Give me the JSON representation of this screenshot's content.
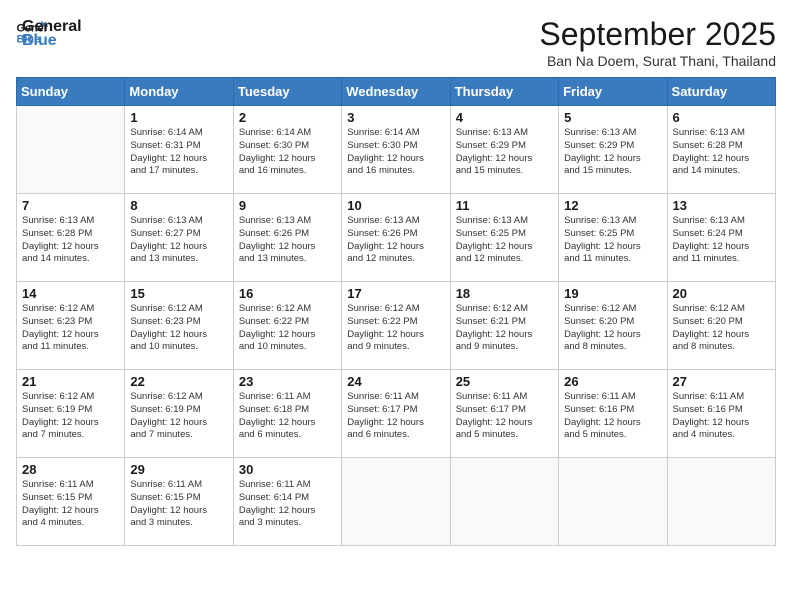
{
  "logo": {
    "line1": "General",
    "line2": "Blue"
  },
  "title": "September 2025",
  "subtitle": "Ban Na Doem, Surat Thani, Thailand",
  "days_of_week": [
    "Sunday",
    "Monday",
    "Tuesday",
    "Wednesday",
    "Thursday",
    "Friday",
    "Saturday"
  ],
  "weeks": [
    [
      {
        "day": "",
        "info": ""
      },
      {
        "day": "1",
        "info": "Sunrise: 6:14 AM\nSunset: 6:31 PM\nDaylight: 12 hours\nand 17 minutes."
      },
      {
        "day": "2",
        "info": "Sunrise: 6:14 AM\nSunset: 6:30 PM\nDaylight: 12 hours\nand 16 minutes."
      },
      {
        "day": "3",
        "info": "Sunrise: 6:14 AM\nSunset: 6:30 PM\nDaylight: 12 hours\nand 16 minutes."
      },
      {
        "day": "4",
        "info": "Sunrise: 6:13 AM\nSunset: 6:29 PM\nDaylight: 12 hours\nand 15 minutes."
      },
      {
        "day": "5",
        "info": "Sunrise: 6:13 AM\nSunset: 6:29 PM\nDaylight: 12 hours\nand 15 minutes."
      },
      {
        "day": "6",
        "info": "Sunrise: 6:13 AM\nSunset: 6:28 PM\nDaylight: 12 hours\nand 14 minutes."
      }
    ],
    [
      {
        "day": "7",
        "info": "Sunrise: 6:13 AM\nSunset: 6:28 PM\nDaylight: 12 hours\nand 14 minutes."
      },
      {
        "day": "8",
        "info": "Sunrise: 6:13 AM\nSunset: 6:27 PM\nDaylight: 12 hours\nand 13 minutes."
      },
      {
        "day": "9",
        "info": "Sunrise: 6:13 AM\nSunset: 6:26 PM\nDaylight: 12 hours\nand 13 minutes."
      },
      {
        "day": "10",
        "info": "Sunrise: 6:13 AM\nSunset: 6:26 PM\nDaylight: 12 hours\nand 12 minutes."
      },
      {
        "day": "11",
        "info": "Sunrise: 6:13 AM\nSunset: 6:25 PM\nDaylight: 12 hours\nand 12 minutes."
      },
      {
        "day": "12",
        "info": "Sunrise: 6:13 AM\nSunset: 6:25 PM\nDaylight: 12 hours\nand 11 minutes."
      },
      {
        "day": "13",
        "info": "Sunrise: 6:13 AM\nSunset: 6:24 PM\nDaylight: 12 hours\nand 11 minutes."
      }
    ],
    [
      {
        "day": "14",
        "info": "Sunrise: 6:12 AM\nSunset: 6:23 PM\nDaylight: 12 hours\nand 11 minutes."
      },
      {
        "day": "15",
        "info": "Sunrise: 6:12 AM\nSunset: 6:23 PM\nDaylight: 12 hours\nand 10 minutes."
      },
      {
        "day": "16",
        "info": "Sunrise: 6:12 AM\nSunset: 6:22 PM\nDaylight: 12 hours\nand 10 minutes."
      },
      {
        "day": "17",
        "info": "Sunrise: 6:12 AM\nSunset: 6:22 PM\nDaylight: 12 hours\nand 9 minutes."
      },
      {
        "day": "18",
        "info": "Sunrise: 6:12 AM\nSunset: 6:21 PM\nDaylight: 12 hours\nand 9 minutes."
      },
      {
        "day": "19",
        "info": "Sunrise: 6:12 AM\nSunset: 6:20 PM\nDaylight: 12 hours\nand 8 minutes."
      },
      {
        "day": "20",
        "info": "Sunrise: 6:12 AM\nSunset: 6:20 PM\nDaylight: 12 hours\nand 8 minutes."
      }
    ],
    [
      {
        "day": "21",
        "info": "Sunrise: 6:12 AM\nSunset: 6:19 PM\nDaylight: 12 hours\nand 7 minutes."
      },
      {
        "day": "22",
        "info": "Sunrise: 6:12 AM\nSunset: 6:19 PM\nDaylight: 12 hours\nand 7 minutes."
      },
      {
        "day": "23",
        "info": "Sunrise: 6:11 AM\nSunset: 6:18 PM\nDaylight: 12 hours\nand 6 minutes."
      },
      {
        "day": "24",
        "info": "Sunrise: 6:11 AM\nSunset: 6:17 PM\nDaylight: 12 hours\nand 6 minutes."
      },
      {
        "day": "25",
        "info": "Sunrise: 6:11 AM\nSunset: 6:17 PM\nDaylight: 12 hours\nand 5 minutes."
      },
      {
        "day": "26",
        "info": "Sunrise: 6:11 AM\nSunset: 6:16 PM\nDaylight: 12 hours\nand 5 minutes."
      },
      {
        "day": "27",
        "info": "Sunrise: 6:11 AM\nSunset: 6:16 PM\nDaylight: 12 hours\nand 4 minutes."
      }
    ],
    [
      {
        "day": "28",
        "info": "Sunrise: 6:11 AM\nSunset: 6:15 PM\nDaylight: 12 hours\nand 4 minutes."
      },
      {
        "day": "29",
        "info": "Sunrise: 6:11 AM\nSunset: 6:15 PM\nDaylight: 12 hours\nand 3 minutes."
      },
      {
        "day": "30",
        "info": "Sunrise: 6:11 AM\nSunset: 6:14 PM\nDaylight: 12 hours\nand 3 minutes."
      },
      {
        "day": "",
        "info": ""
      },
      {
        "day": "",
        "info": ""
      },
      {
        "day": "",
        "info": ""
      },
      {
        "day": "",
        "info": ""
      }
    ]
  ]
}
